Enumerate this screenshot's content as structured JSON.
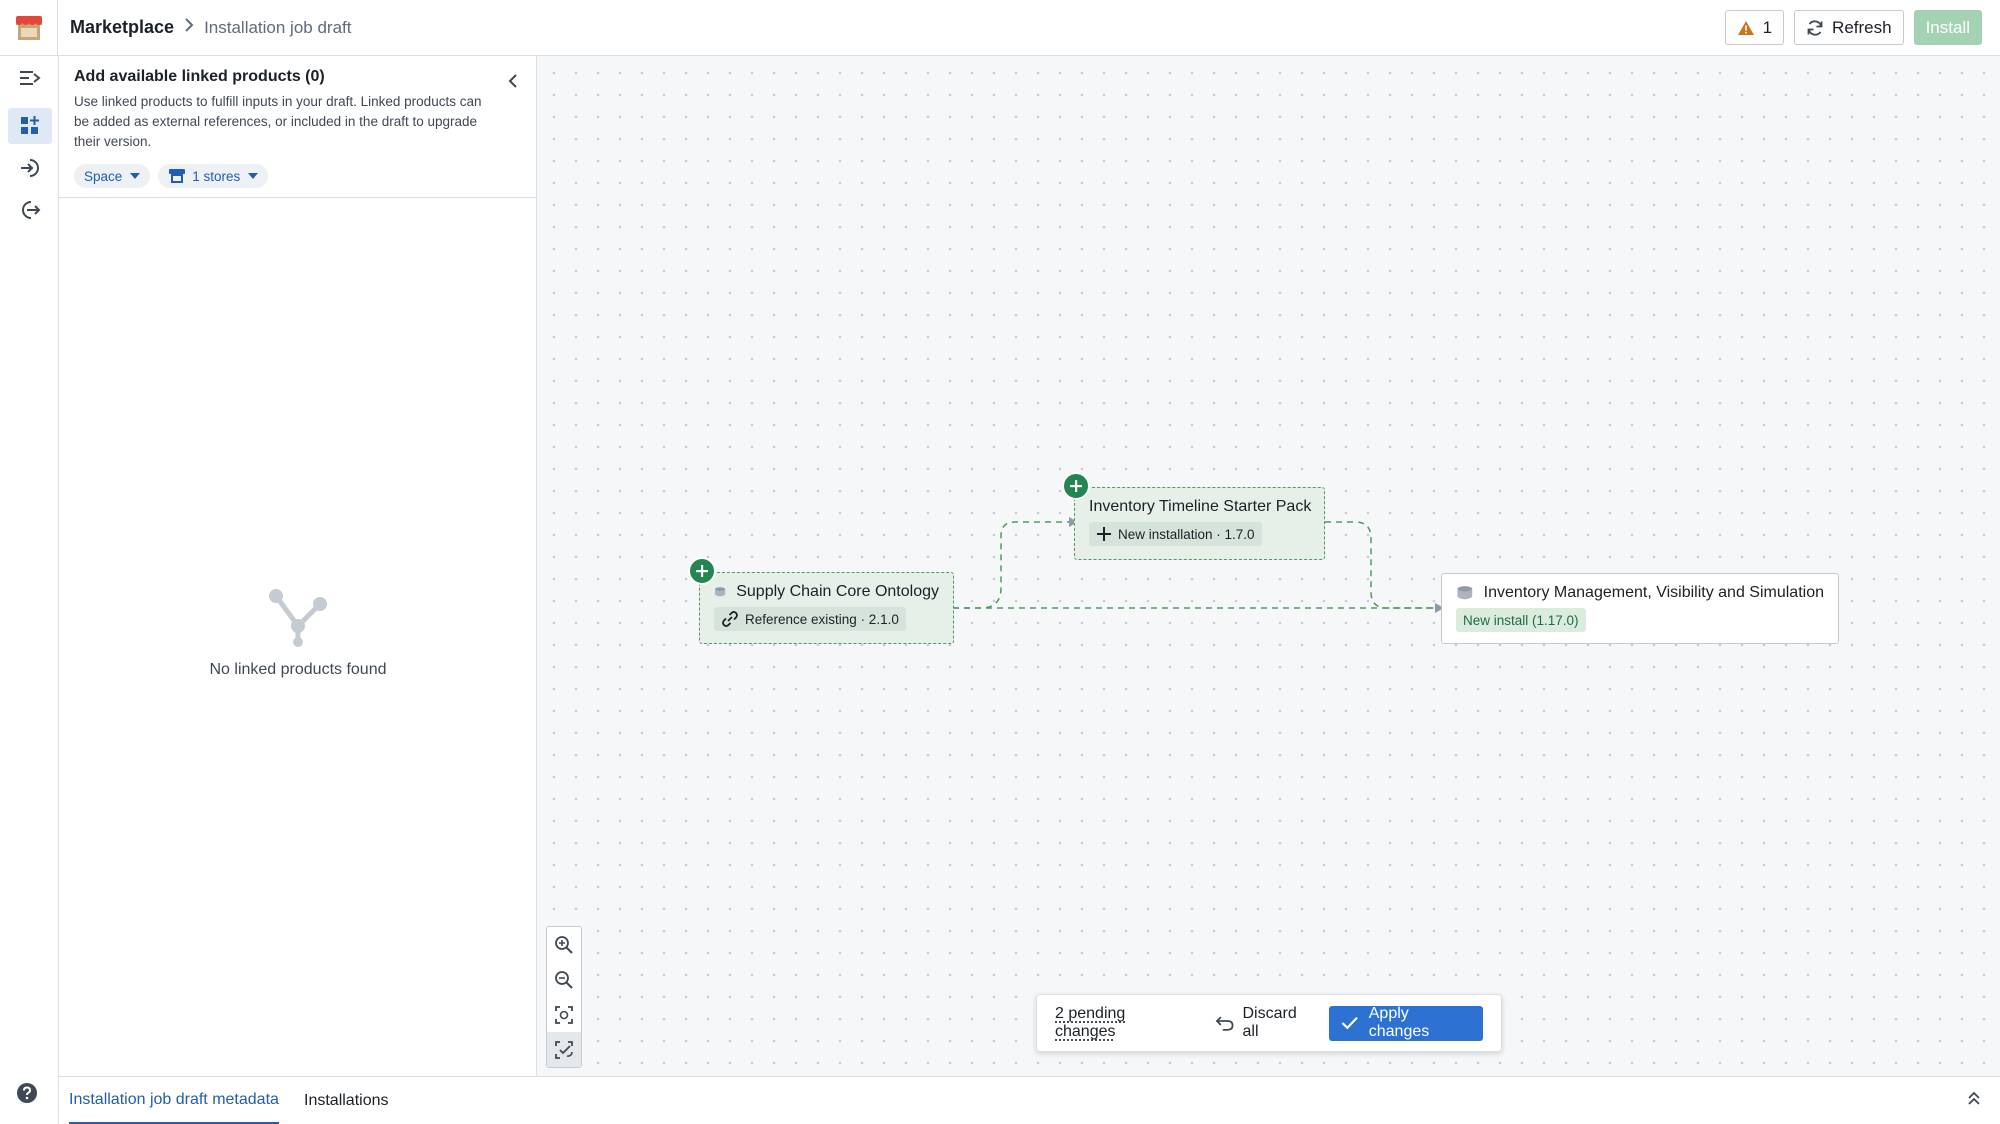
{
  "header": {
    "breadcrumb_root": "Marketplace",
    "breadcrumb_current": "Installation job draft",
    "warning_count": "1",
    "refresh_label": "Refresh",
    "install_label": "Install"
  },
  "panel": {
    "title": "Add available linked products (0)",
    "description": "Use linked products to fulfill inputs in your draft. Linked products can be added as external references, or included in the draft to upgrade their version.",
    "filter_space": "Space",
    "filter_stores": "1 stores",
    "empty_text": "No linked products found"
  },
  "nodes": {
    "supply_chain": {
      "title": "Supply Chain Core Ontology",
      "tag": "Reference existing · 2.1.0"
    },
    "timeline": {
      "title": "Inventory Timeline Starter Pack",
      "tag": "New installation · 1.7.0"
    },
    "inventory": {
      "title": "Inventory Management, Visibility and Simulation",
      "tag": "New install (1.17.0)"
    }
  },
  "pending": {
    "count_label": "2 pending changes",
    "discard_label": "Discard all",
    "apply_label": "Apply changes"
  },
  "tabs": {
    "metadata": "Installation job draft metadata",
    "installations": "Installations"
  },
  "colors": {
    "accent_blue": "#2d72d2",
    "success_green": "#238551",
    "install_disabled": "#a3d3b3",
    "warning": "#c87619"
  }
}
